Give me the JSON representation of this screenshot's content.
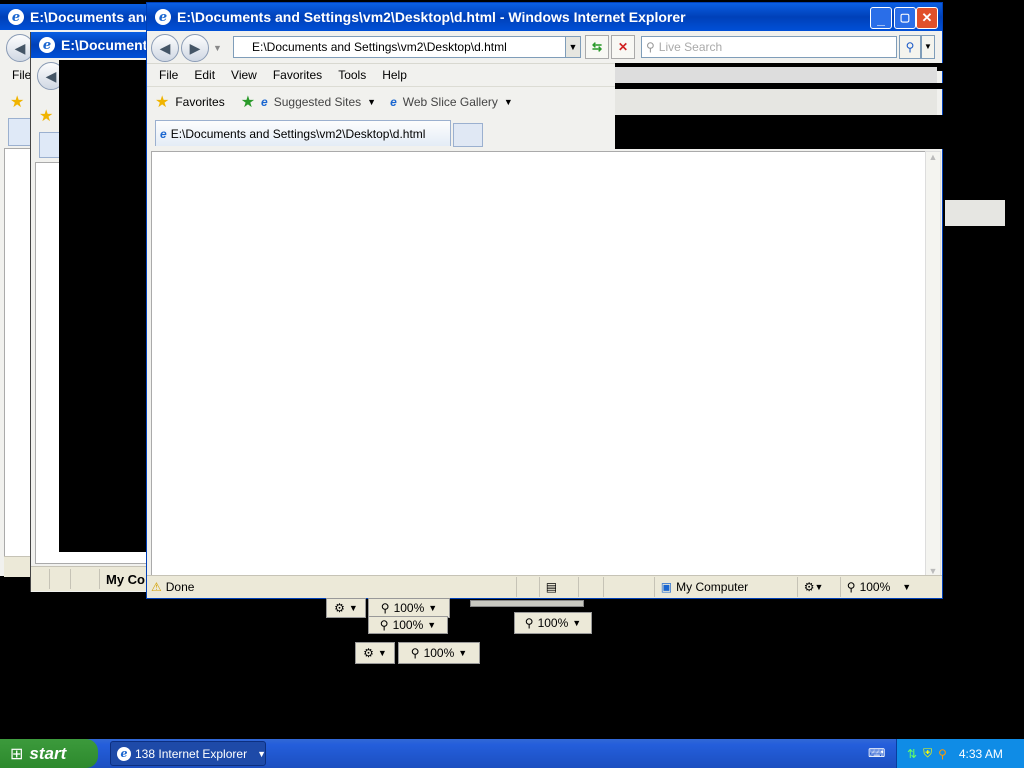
{
  "back_window": {
    "title": "E:\\Documents and S",
    "menu_first": "File"
  },
  "mid_window": {
    "title": "E:\\Documents a",
    "status_text": "My Co"
  },
  "main_window": {
    "title": "E:\\Documents and Settings\\vm2\\Desktop\\d.html - Windows Internet Explorer",
    "address": "E:\\Documents and Settings\\vm2\\Desktop\\d.html",
    "search_placeholder": "Live Search",
    "menu": [
      "File",
      "Edit",
      "View",
      "Favorites",
      "Tools",
      "Help"
    ],
    "favorites_label": "Favorites",
    "suggested_sites": "Suggested Sites",
    "web_slice_gallery": "Web Slice Gallery",
    "tab_title": "E:\\Documents and Settings\\vm2\\Desktop\\d.html",
    "status_text": "Done",
    "zone": "My Computer",
    "zoom": "100%"
  },
  "ghost_zoom": [
    "100%",
    "100%",
    "100%",
    "100%"
  ],
  "taskbar": {
    "start": "start",
    "task_label": "138 Internet Explorer",
    "clock": "4:33 AM"
  }
}
